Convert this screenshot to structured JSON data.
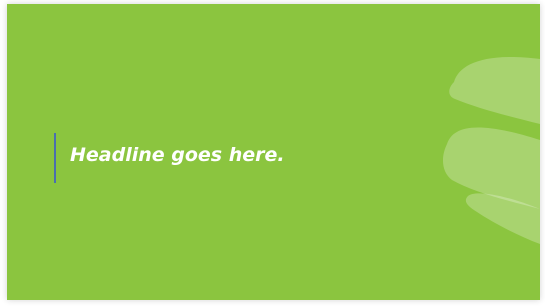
{
  "slide": {
    "headline": "Headline goes here.",
    "background_color": "#8bc53f",
    "accent_bar_color": "#4a6fb0",
    "headline_color": "#ffffff",
    "decoration_icon": "globe-swoosh-graphic"
  }
}
